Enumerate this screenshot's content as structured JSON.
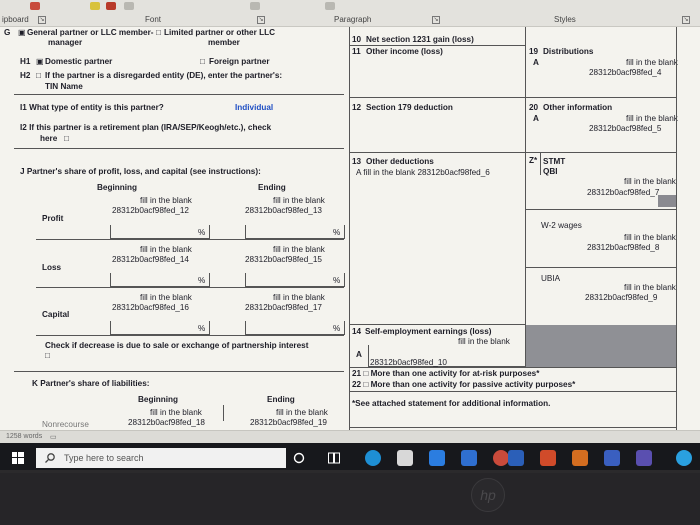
{
  "ribbon": {
    "clipboard": "ipboard",
    "font": "Font",
    "paragraph": "Paragraph",
    "styles": "Styles"
  },
  "form": {
    "g_letter": "G",
    "g_general_partner": "General partner or LLC member-",
    "g_manager": "manager",
    "g_limited_partner": "Limited partner or other LLC",
    "g_member": "member",
    "h1_letter": "H1",
    "h1_domestic": "Domestic partner",
    "h1_foreign": "Foreign partner",
    "h2_letter": "H2",
    "h2_text": "If the partner is a disregarded entity (DE), enter the partner's:",
    "h2_tin": "TIN  Name",
    "i1_label": "I1  What type of entity is this partner?",
    "i1_value": "Individual",
    "i2_label": "I2  If this partner is a retirement plan (IRA/SEP/Keogh/etc.), check",
    "i2_here": "here",
    "j_label": "J   Partner's share of profit, loss, and capital (see instructions):",
    "j_beginning": "Beginning",
    "j_ending": "Ending",
    "profit": "Profit",
    "loss": "Loss",
    "capital": "Capital",
    "fill_blank": "fill in the blank",
    "pct": "%",
    "f12": "28312b0acf98fed_12",
    "f13": "28312b0acf98fed_13",
    "f14": "28312b0acf98fed_14",
    "f15": "28312b0acf98fed_15",
    "f16": "28312b0acf98fed_16",
    "f17": "28312b0acf98fed_17",
    "check_decrease": "Check if decrease is due to sale or exchange of partnership interest",
    "k_label": "K   Partner's share of liabilities:",
    "k_beginning": "Beginning",
    "k_ending": "Ending",
    "f18": "28312b0acf98fed_18",
    "f19": "28312b0acf98fed_19",
    "nonrecourse": "Nonrecourse"
  },
  "lines": {
    "l10_num": "10",
    "l10_text": "Net section 1231 gain (loss)",
    "l11_num": "11",
    "l11_text": "Other income (loss)",
    "l12_num": "12",
    "l12_text": "Section 179 deduction",
    "l13_num": "13",
    "l13_text": "Other deductions",
    "l13_a": "A  fill in the blank 28312b0acf98fed_6",
    "l14_num": "14",
    "l14_text": "Self-employment earnings (loss)",
    "l14_fill": "fill in the blank",
    "l14_a": "A",
    "l14_code": "28312b0acf98fed_10",
    "l19_num": "19",
    "l19_text": "Distributions",
    "l19_a": "A",
    "l19_fill": "fill in the blank",
    "l19_code": "28312b0acf98fed_4",
    "l20_num": "20",
    "l20_text": "Other information",
    "l20_a": "A",
    "l20_fill": "fill in the blank",
    "l20_code": "28312b0acf98fed_5",
    "z_code": "Z*",
    "z_stmt": "STMT",
    "z_qbi": "QBI",
    "r7_fill": "fill in the blank",
    "r7_code": "28312b0acf98fed_7",
    "w2": "W-2 wages",
    "r8_fill": "fill in the blank",
    "r8_code": "28312b0acf98fed_8",
    "ubia": "UBIA",
    "r9_fill": "fill in the blank",
    "r9_code": "28312b0acf98fed_9",
    "l21": "21 □ More than one activity for at-risk purposes*",
    "l22": "22 □ More than one activity for passive activity purposes*",
    "see_attached": "*See attached statement for additional information."
  },
  "status": {
    "words": "1258 words"
  },
  "taskbar": {
    "search_placeholder": "Type here to search"
  },
  "colors": {
    "accent_blue": "#1f4fc4",
    "taskbar": "#17181c"
  }
}
